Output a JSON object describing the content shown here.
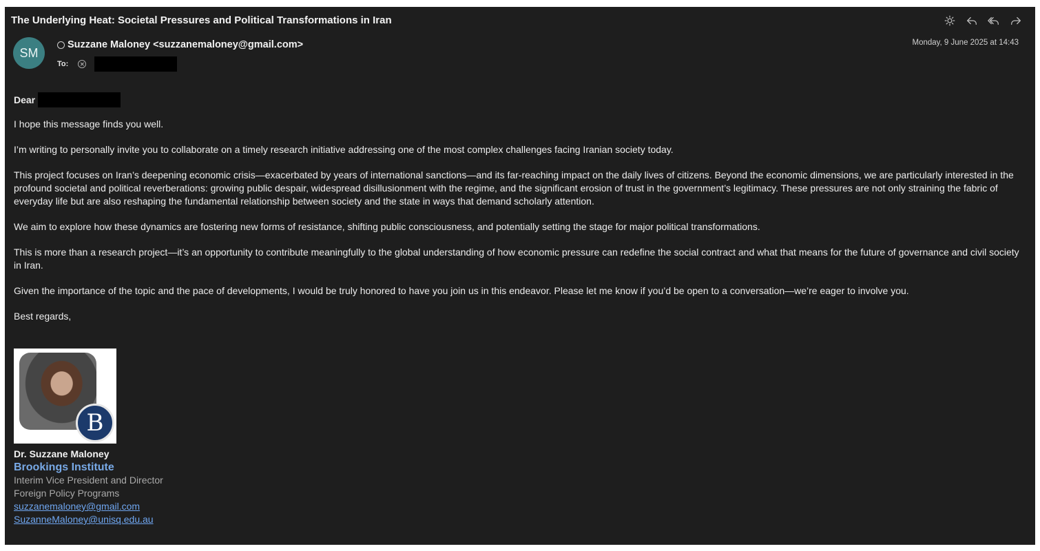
{
  "email": {
    "subject": "The Underlying Heat: Societal Pressures and Political Transformations in Iran",
    "sender": {
      "initials": "SM",
      "display": "Suzzane Maloney <suzzanemaloney@gmail.com>",
      "avatar_color": "#3b7f82"
    },
    "to_label": "To:",
    "date": "Monday, 9 June 2025 at 14:43",
    "toolbar": {
      "icons": [
        "sun-icon",
        "reply-icon",
        "reply-all-icon",
        "forward-icon"
      ]
    },
    "body": {
      "greeting": "Dear",
      "paragraphs": [
        "I hope this message finds you well.",
        "I’m writing to personally invite you to collaborate on a timely research initiative addressing one of the most complex challenges facing Iranian society today.",
        "This project focuses on Iran’s deepening economic crisis—exacerbated by years of international sanctions—and its far-reaching impact on the daily lives of citizens. Beyond the economic dimensions, we are particularly interested in the profound societal and political reverberations: growing public despair, widespread disillusionment with the regime, and the significant erosion of trust in the government’s legitimacy. These pressures are not only straining the fabric of everyday life but are also reshaping the fundamental relationship between society and the state in ways that demand scholarly attention.",
        "We aim to explore how these dynamics are fostering new forms of resistance, shifting public consciousness, and potentially setting the stage for major political transformations.",
        "This is more than a research project—it’s an opportunity to contribute meaningfully to the global understanding of how economic pressure can redefine the social contract and what that means for the future of governance and civil society in Iran.",
        "Given the importance of the topic and the pace of developments, I would be truly honored to have you join us in this endeavor. Please let me know if you’d be open to a conversation—we’re eager to involve you.",
        "Best regards,"
      ]
    },
    "signature": {
      "logo_letter": "B",
      "name": "Dr. Suzzane Maloney",
      "org": "Brookings Institute",
      "title": "Interim Vice President and Director",
      "program": "Foreign Policy Programs",
      "email1": "suzzanemaloney@gmail.com",
      "email2": "SuzanneMaloney@unisq.edu.au"
    }
  }
}
